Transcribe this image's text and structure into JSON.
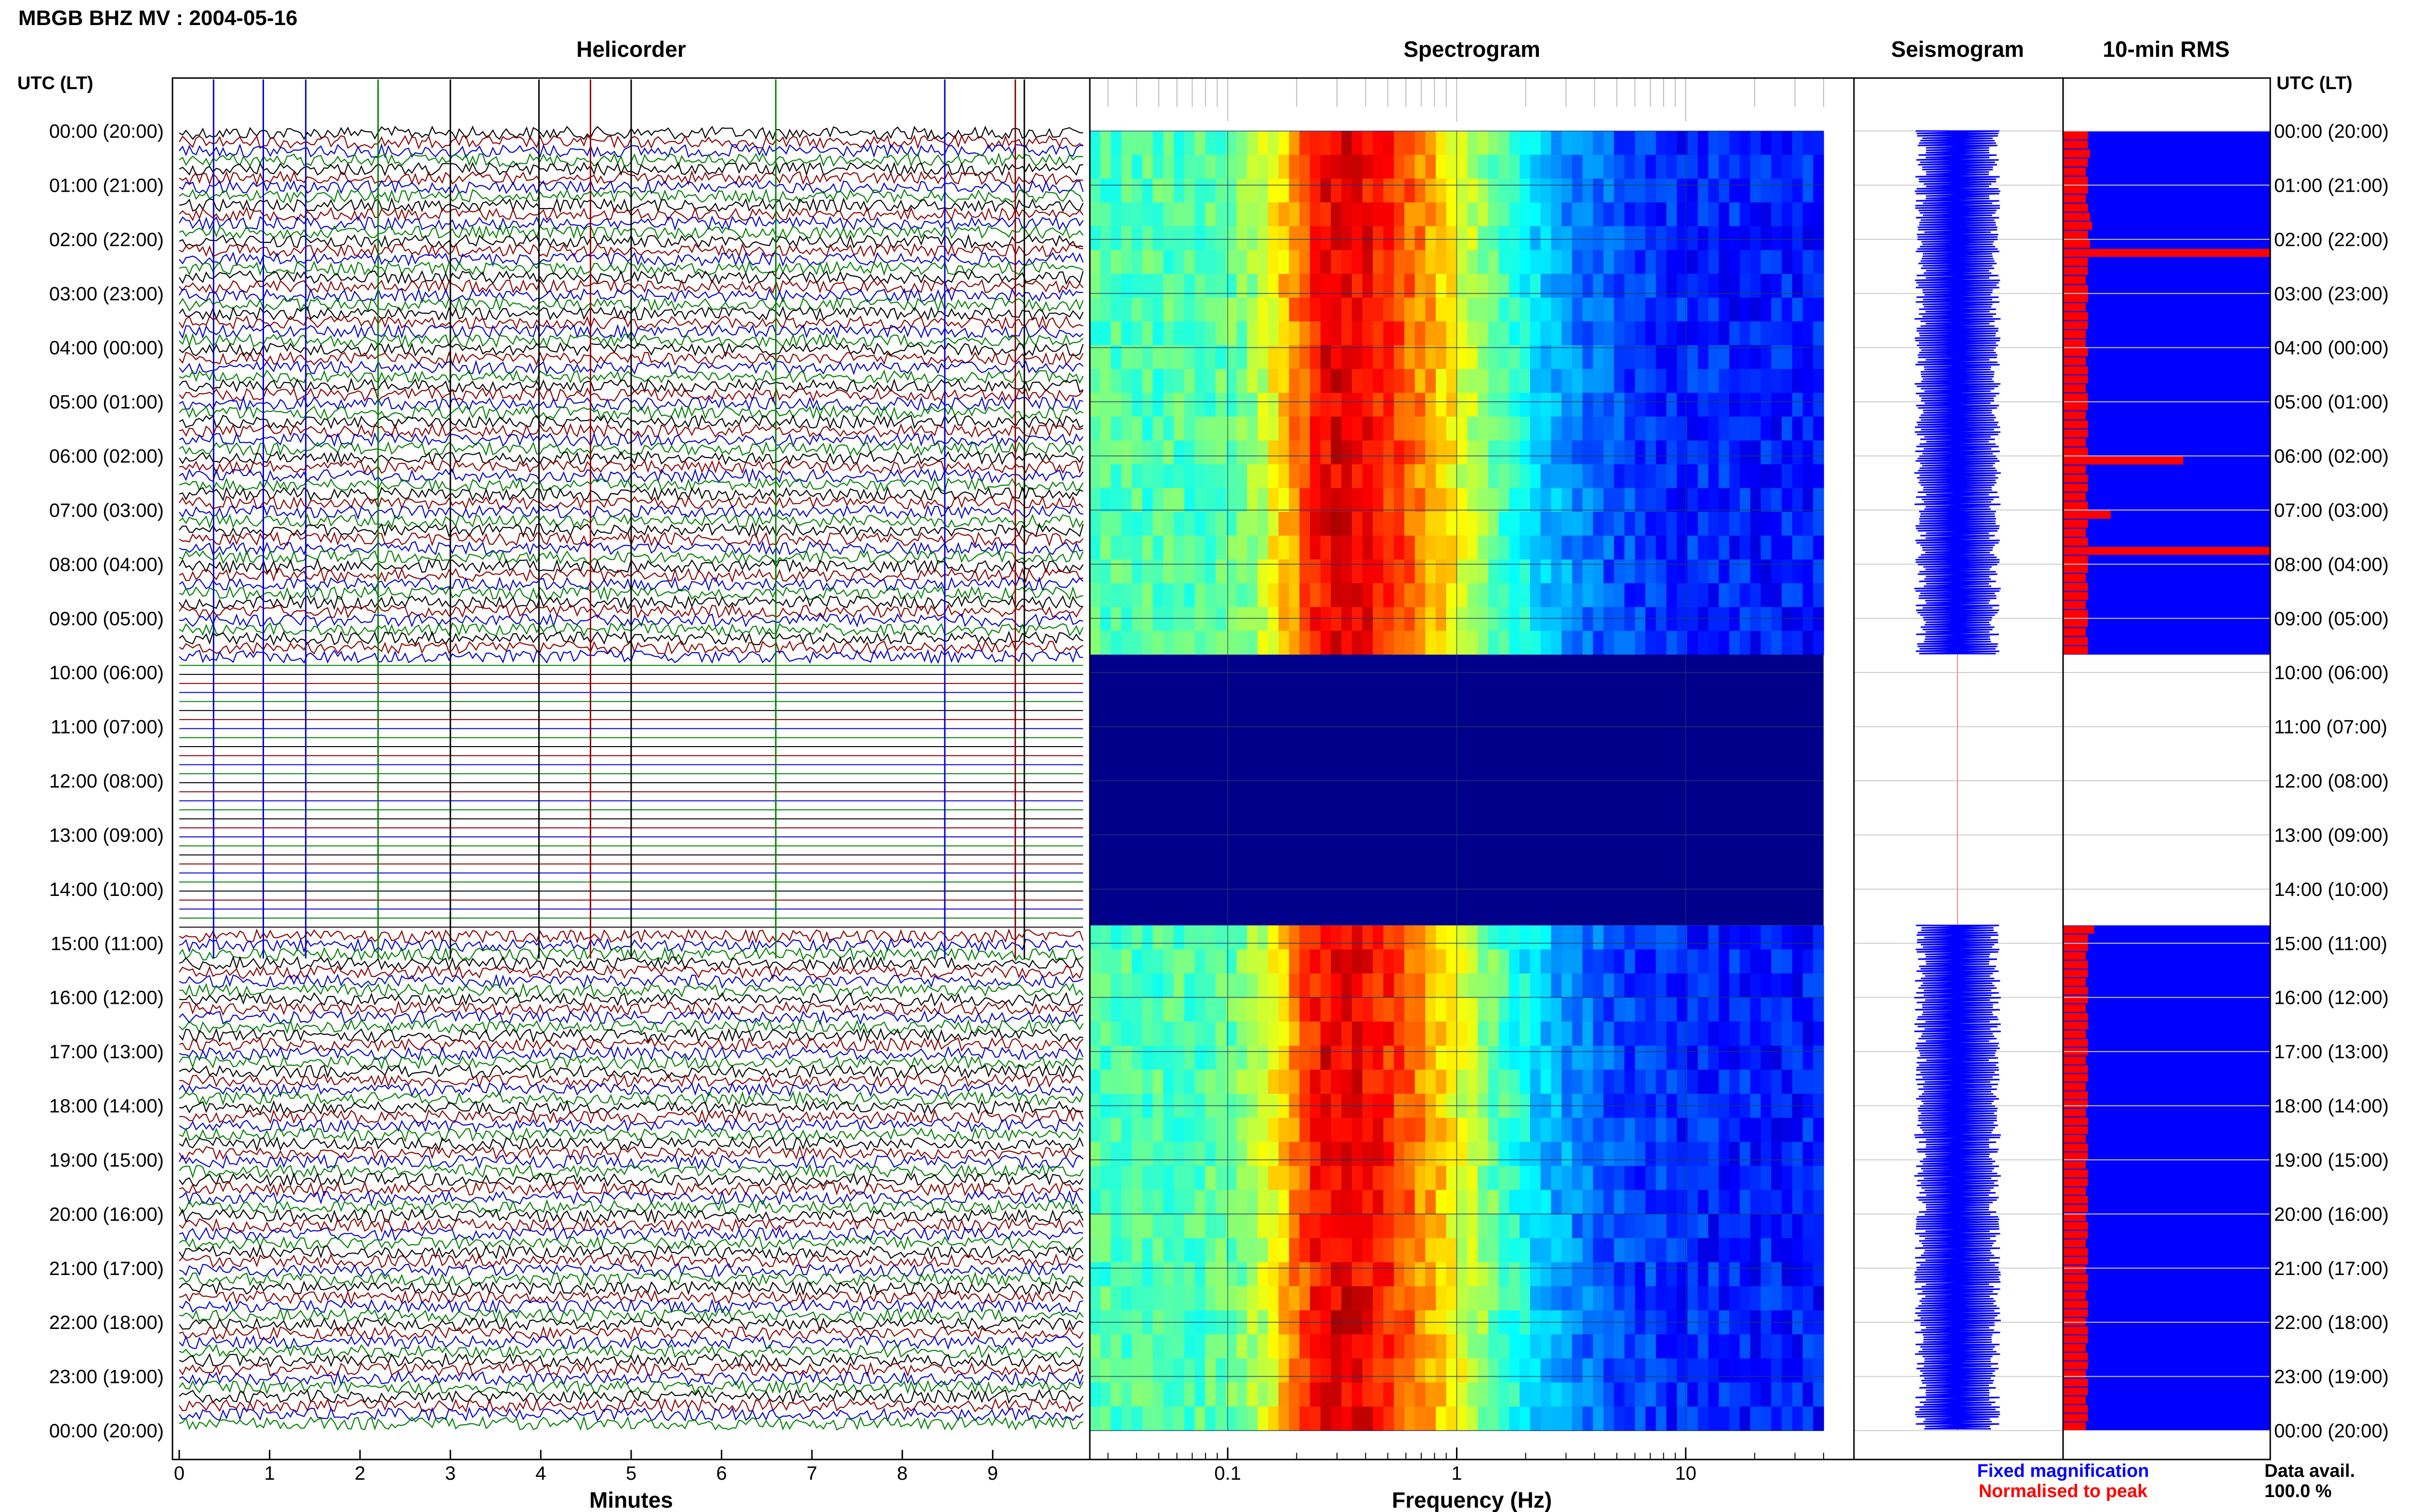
{
  "header": {
    "title": "MBGB BHZ MV : 2004-05-16",
    "utc_lt_label": "UTC (LT)"
  },
  "panels": {
    "helicorder": "Helicorder",
    "spectrogram": "Spectrogram",
    "seismogram": "Seismogram",
    "rms": "10-min RMS"
  },
  "footer": {
    "minutes_label": "Minutes",
    "frequency_label": "Frequency (Hz)",
    "fixed_magnification": "Fixed magnification",
    "normalised_to_peak": "Normalised to peak",
    "data_avail_label": "Data avail.",
    "data_avail_value": "100.0 %"
  },
  "colors": {
    "fixed_magnification": "#0000ff",
    "normalised_to_peak": "#ff0000",
    "trace_colors": [
      "#000000",
      "#8b0000",
      "#0000cc",
      "#008000"
    ],
    "spectrogram_empty": "#00008b",
    "rms_background": "#0000ff",
    "rms_bar": "#ff0000"
  },
  "chart_data": [
    {
      "type": "line",
      "name": "helicorder",
      "title": "Helicorder",
      "xlabel": "Minutes",
      "x_ticks": [
        "0",
        "1",
        "2",
        "3",
        "4",
        "5",
        "6",
        "7",
        "8",
        "9"
      ],
      "xlim": [
        0,
        10
      ],
      "y_ticks": [
        "00:00 (20:00)",
        "01:00 (21:00)",
        "02:00 (22:00)",
        "03:00 (23:00)",
        "04:00 (00:00)",
        "05:00 (01:00)",
        "06:00 (02:00)",
        "07:00 (03:00)",
        "08:00 (04:00)",
        "09:00 (05:00)",
        "10:00 (06:00)",
        "11:00 (07:00)",
        "12:00 (08:00)",
        "13:00 (09:00)",
        "14:00 (10:00)",
        "15:00 (11:00)",
        "16:00 (12:00)",
        "17:00 (13:00)",
        "18:00 (14:00)",
        "19:00 (15:00)",
        "20:00 (16:00)",
        "21:00 (17:00)",
        "22:00 (18:00)",
        "23:00 (19:00)",
        "00:00 (20:00)"
      ],
      "data_gap_hours": [
        9.67,
        14.67
      ]
    },
    {
      "type": "heatmap",
      "name": "spectrogram",
      "title": "Spectrogram",
      "xlabel": "Frequency (Hz)",
      "x_scale": "log",
      "x_ticks": [
        "0.1",
        "1",
        "10"
      ],
      "xlim": [
        0.025,
        40
      ],
      "peak_band_hz": [
        0.2,
        0.45
      ],
      "data_gap_hours": [
        9.67,
        14.67
      ]
    },
    {
      "type": "line",
      "name": "seismogram",
      "title": "Seismogram",
      "series": [
        {
          "name": "Fixed magnification",
          "color": "#0000ff"
        },
        {
          "name": "Normalised to peak",
          "color": "#ff0000"
        }
      ],
      "data_gap_hours": [
        9.67,
        14.67
      ]
    },
    {
      "type": "bar",
      "name": "rms",
      "title": "10-min RMS",
      "orientation": "horizontal",
      "bin_minutes": 10,
      "values_am": [
        0.12,
        0.12,
        0.13,
        0.12,
        0.11,
        0.12,
        0.12,
        0.11,
        0.12,
        0.13,
        0.14,
        0.12,
        0.13,
        1.0,
        0.12,
        0.12,
        0.11,
        0.12,
        0.12,
        0.11,
        0.12,
        0.12,
        0.11,
        0.11,
        0.12,
        0.11,
        0.12,
        0.12,
        0.11,
        0.12,
        0.12,
        0.11,
        0.12,
        0.12,
        0.11,
        0.12,
        0.58,
        0.11,
        0.12,
        0.12,
        0.11,
        0.12,
        0.23,
        0.12,
        0.11,
        0.12,
        1.0,
        0.12,
        0.12,
        0.11,
        0.12,
        0.12,
        0.11,
        0.12,
        0.12,
        0.11,
        0.12,
        0.12
      ],
      "values_pm": [
        0.15,
        0.12,
        0.12,
        0.11,
        0.12,
        0.12,
        0.11,
        0.12,
        0.12,
        0.11,
        0.12,
        0.12,
        0.11,
        0.12,
        0.12,
        0.11,
        0.12,
        0.12,
        0.11,
        0.12,
        0.12,
        0.11,
        0.12,
        0.12,
        0.11,
        0.12,
        0.12,
        0.11,
        0.12,
        0.12,
        0.11,
        0.12,
        0.12,
        0.11,
        0.12,
        0.12,
        0.11,
        0.12,
        0.12,
        0.11,
        0.12,
        0.12,
        0.11,
        0.12,
        0.12,
        0.11,
        0.12,
        0.12,
        0.11,
        0.12,
        0.12,
        0.11,
        0.12,
        0.12,
        0.11,
        0.12,
        0.12,
        0.11
      ]
    }
  ]
}
